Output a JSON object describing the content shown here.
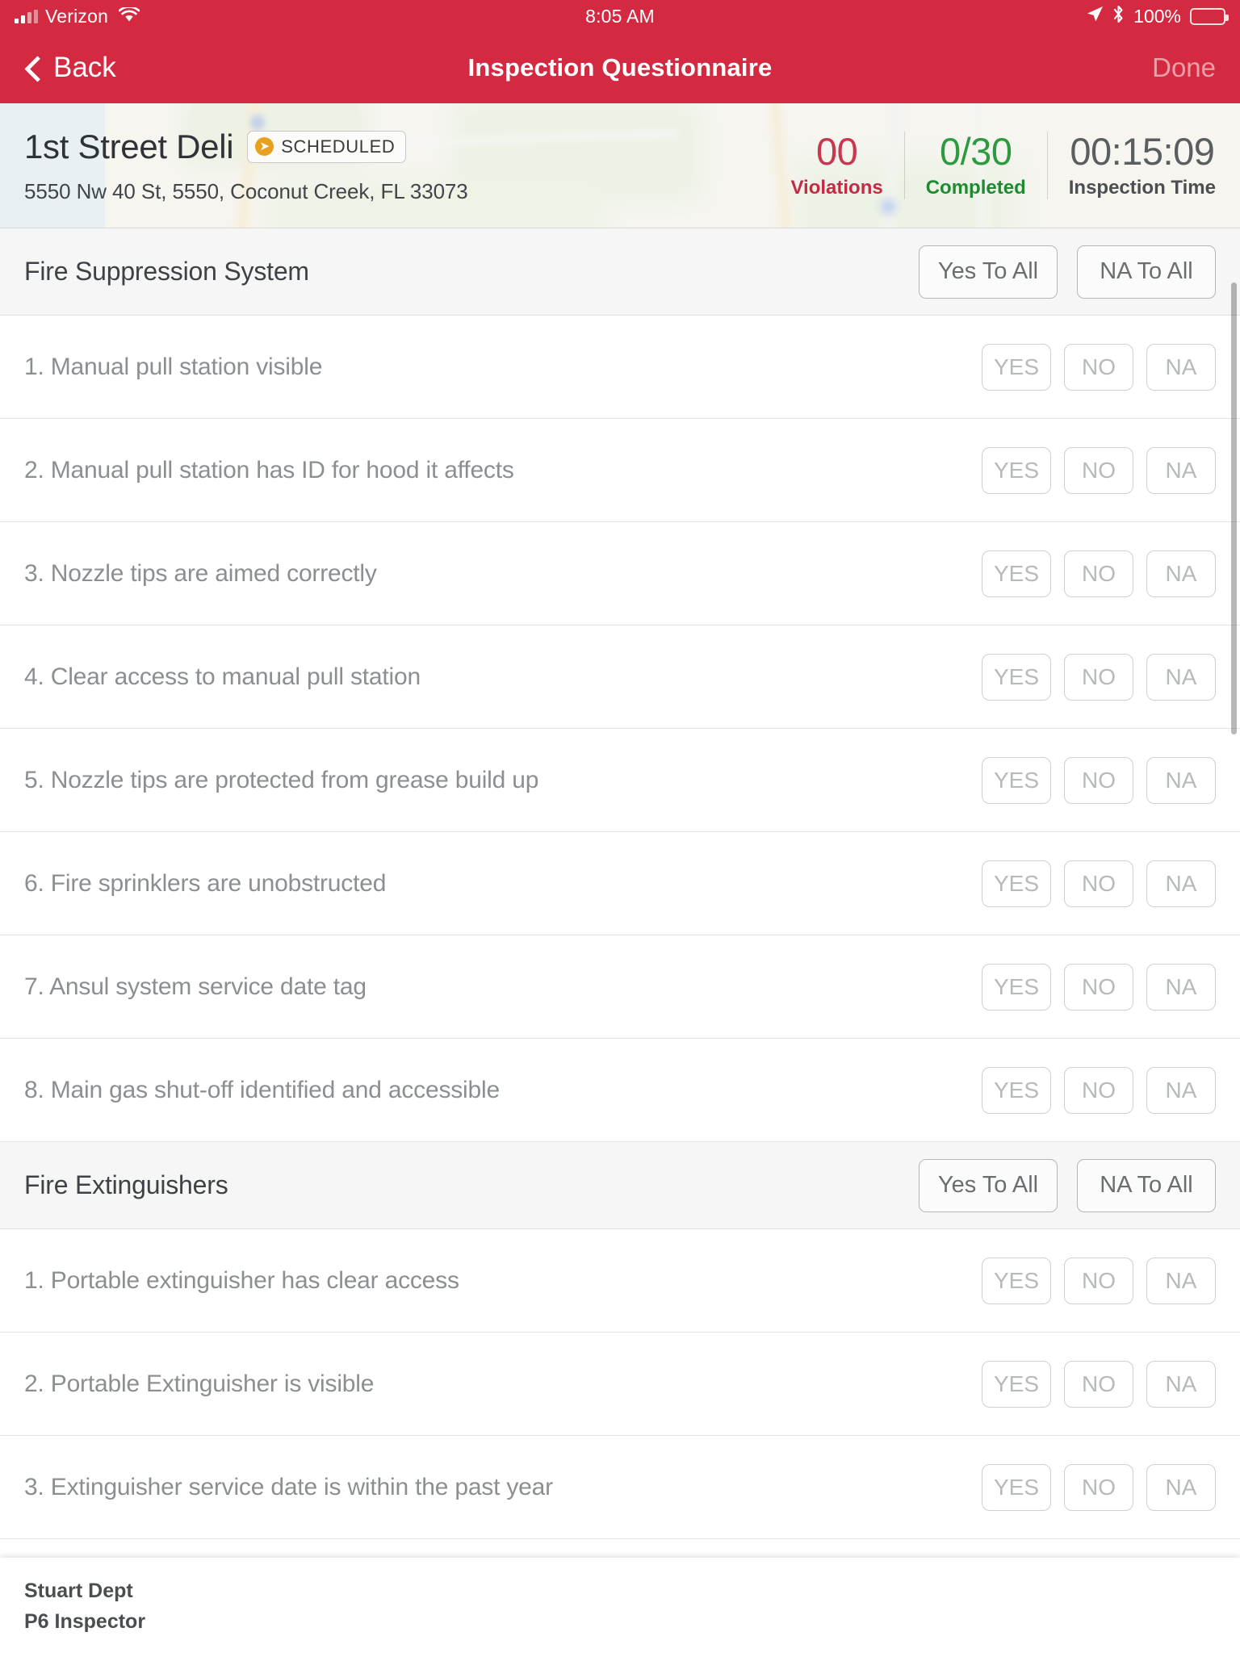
{
  "status_bar": {
    "carrier": "Verizon",
    "time": "8:05 AM",
    "battery_percent": "100%",
    "signal_icon": "signal-bars-icon",
    "wifi_icon": "wifi-icon",
    "location_icon": "location-arrow-icon",
    "bluetooth_icon": "bluetooth-icon",
    "battery_icon": "battery-full-icon"
  },
  "nav_bar": {
    "back_label": "Back",
    "title": "Inspection Questionnaire",
    "done_label": "Done",
    "accent_color": "#d32a42"
  },
  "info_header": {
    "business_name": "1st Street Deli",
    "status_badge": "SCHEDULED",
    "badge_color": "#e8a01f",
    "address": "5550 Nw 40 St, 5550, Coconut Creek, FL 33073",
    "stats": [
      {
        "value": "00",
        "label": "Violations",
        "color": "#c22b45"
      },
      {
        "value": "0/30",
        "label": "Completed",
        "color": "#1f8a32"
      },
      {
        "value": "00:15:09",
        "label": "Inspection Time",
        "color": "#4b4f52"
      }
    ]
  },
  "bulk_actions": {
    "yes_to_all": "Yes To All",
    "na_to_all": "NA To All"
  },
  "answer_options": {
    "yes": "YES",
    "no": "NO",
    "na": "NA"
  },
  "sections": [
    {
      "title": "Fire Suppression System",
      "questions": [
        "1. Manual pull station visible",
        "2. Manual pull station has ID for hood it affects",
        "3. Nozzle tips are aimed correctly",
        "4. Clear access to manual pull station",
        "5. Nozzle tips are protected from grease build up",
        "6. Fire sprinklers are unobstructed",
        "7. Ansul system service date tag",
        "8. Main gas shut-off identified and accessible"
      ]
    },
    {
      "title": "Fire Extinguishers",
      "questions": [
        "1. Portable extinguisher has clear access",
        "2. Portable Extinguisher is visible",
        "3. Extinguisher service date is within the past year"
      ]
    }
  ],
  "footer": {
    "department": "Stuart Dept",
    "inspector": "P6 Inspector"
  }
}
